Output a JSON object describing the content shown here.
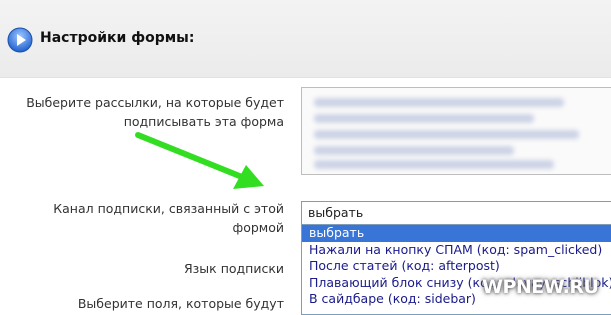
{
  "header": {
    "title": "Настройки формы:"
  },
  "labels": {
    "mailing": "Выберите рассылки, на которые будет подписывать эта форма",
    "channel": "Канал подписки, связанный с этой формой",
    "language": "Язык подписки",
    "fields": "Выберите поля, которые будут"
  },
  "channel_select": {
    "value": "выбрать",
    "options": [
      "выбрать",
      "Нажали на кнопку СПАМ (код: spam_clicked)",
      "После статей (код: afterpost)",
      "Плавающий блок снизу (код: plavayuschijblok)",
      "В сайдбаре (код: sidebar)"
    ]
  },
  "watermark": "WPNEW.RU",
  "colors": {
    "accent": "#3875d7",
    "arrow": "#33dd22",
    "icon": "#2e6fd6"
  },
  "icons": {
    "header": "play-circle-icon",
    "annotation": "arrow-icon"
  }
}
